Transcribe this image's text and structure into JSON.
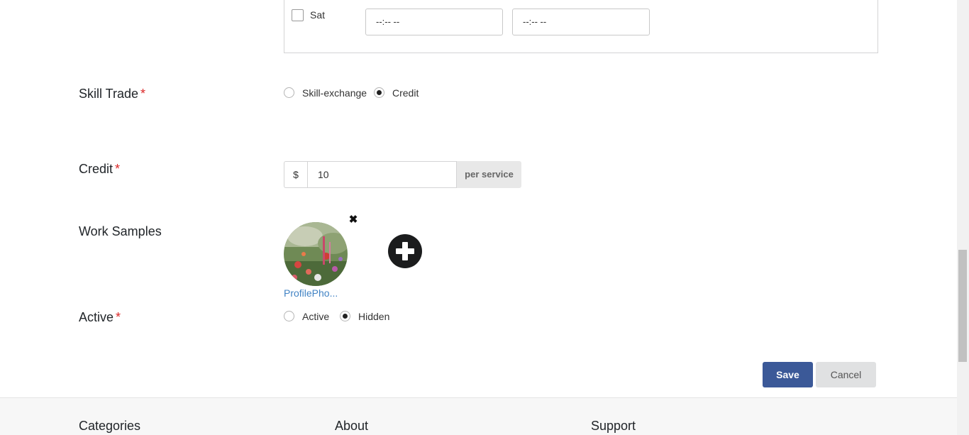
{
  "availability": {
    "day_label": "Sat",
    "start_time": "--:-- --",
    "end_time": "--:-- --"
  },
  "skill_trade": {
    "label": "Skill Trade",
    "required_mark": "*",
    "options": [
      "Skill-exchange",
      "Credit"
    ],
    "selected": "Credit"
  },
  "credit": {
    "label": "Credit",
    "required_mark": "*",
    "prefix": "$",
    "value": "10",
    "suffix": "per service"
  },
  "work_samples": {
    "label": "Work Samples",
    "file_name": "ProfilePho...",
    "remove_glyph": "✖",
    "add_icon": "plus-circle-icon"
  },
  "active": {
    "label": "Active",
    "required_mark": "*",
    "options": [
      "Active",
      "Hidden"
    ],
    "selected": "Hidden"
  },
  "actions": {
    "save_label": "Save",
    "cancel_label": "Cancel"
  },
  "footer": {
    "headings": [
      "Categories",
      "About",
      "Support"
    ]
  },
  "colors": {
    "primary": "#3b5998",
    "required": "#db2828",
    "link": "#4183c4"
  }
}
